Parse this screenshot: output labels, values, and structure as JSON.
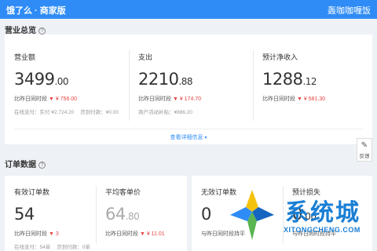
{
  "header": {
    "app_title": "饿了么 · 商家版",
    "shop_name": "轰咖咖喱饭"
  },
  "overview": {
    "title": "营业总览",
    "metrics": [
      {
        "label": "营业额",
        "value_int": "3499",
        "value_dec": ".00",
        "compare_label": "比昨日同时段",
        "compare_delta": "▼ ¥ 756.00",
        "sub": [
          "在线支付：实付 ¥2,724.20",
          "货到付款：¥0.00"
        ]
      },
      {
        "label": "支出",
        "value_int": "2210",
        "value_dec": ".88",
        "compare_label": "比昨日同时段",
        "compare_delta": "▼ ¥ 174.70",
        "sub": [
          "商户活动补贴：¥886.20"
        ]
      },
      {
        "label": "预计净收入",
        "value_int": "1288",
        "value_dec": ".12",
        "compare_label": "比昨日同时段",
        "compare_delta": "▼ ¥ 581.30",
        "sub": []
      }
    ],
    "detail_link": "查看详细信息"
  },
  "feedback_label": "反馈",
  "orders": {
    "title": "订单数据",
    "metrics": [
      {
        "label": "有效订单数",
        "value_int": "54",
        "value_dec": "",
        "compare_label": "比昨日同时段",
        "compare_delta": "▼ 3",
        "sub": [
          "在线支付：54单",
          "货到付款：0单"
        ]
      },
      {
        "label": "平均客单价",
        "value_int": "64",
        "value_dec": ".80",
        "compare_label": "比昨日同时段",
        "compare_delta": "▼ ¥ 11.01",
        "sub": []
      },
      {
        "label": "无效订单数",
        "value_int": "0",
        "value_dec": "",
        "compare_label": "与昨日同时段持平",
        "compare_delta": "",
        "sub": []
      },
      {
        "label": "预计损失",
        "value_int": "0",
        "value_dec": ".00",
        "compare_label": "与昨日同时段持平",
        "compare_delta": "",
        "sub": []
      }
    ]
  },
  "watermark": {
    "text": "系统城",
    "url": "XITONGCHENG.COM"
  },
  "colors": {
    "header_blue": "#2f8cf6",
    "delta_red": "#e64340",
    "page_bg": "#eef1f5"
  }
}
